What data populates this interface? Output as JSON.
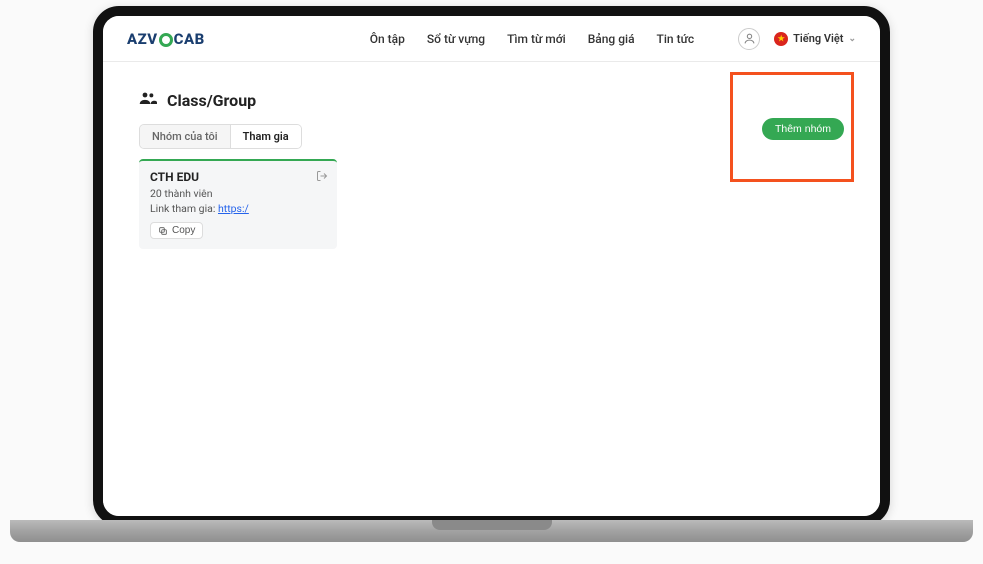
{
  "logo": {
    "prefix": "AZV",
    "suffix": "CAB"
  },
  "nav": {
    "items": [
      "Ôn tập",
      "Sổ từ vựng",
      "Tìm từ mới",
      "Bảng giá",
      "Tin tức"
    ]
  },
  "lang": {
    "label": "Tiếng Việt"
  },
  "page": {
    "title": "Class/Group"
  },
  "tabs": {
    "my_group": "Nhóm của tôi",
    "join": "Tham gia"
  },
  "card": {
    "title": "CTH EDU",
    "members": "20 thành viên",
    "link_label": "Link tham gia:",
    "link_value": "https:/",
    "copy": "Copy"
  },
  "actions": {
    "add_group": "Thêm nhóm"
  }
}
